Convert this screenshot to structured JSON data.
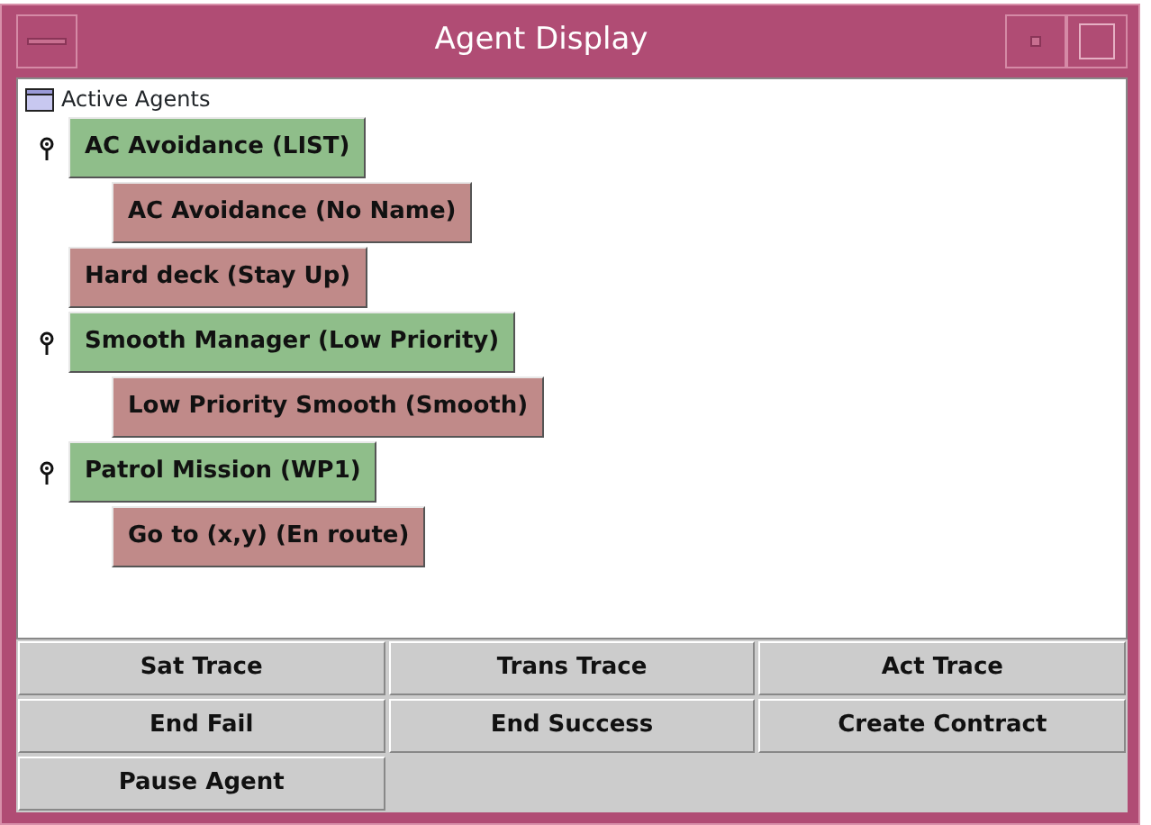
{
  "window": {
    "title": "Agent Display"
  },
  "tree": {
    "root": "Active Agents",
    "items": [
      {
        "label": "AC Avoidance (LIST)",
        "color": "#8fbe8a",
        "children": [
          {
            "label": "AC Avoidance (No Name)",
            "color": "#c08a89"
          }
        ]
      },
      {
        "label": "Hard deck (Stay Up)",
        "color": "#c08a89"
      },
      {
        "label": "Smooth Manager (Low Priority)",
        "color": "#8fbe8a",
        "children": [
          {
            "label": "Low Priority Smooth (Smooth)",
            "color": "#c08a89"
          }
        ]
      },
      {
        "label": "Patrol Mission (WP1)",
        "color": "#8fbe8a",
        "children": [
          {
            "label": "Go to (x,y) (En route)",
            "color": "#c08a89"
          }
        ]
      }
    ]
  },
  "buttons": [
    "Sat Trace",
    "Trans Trace",
    "Act Trace",
    "End Fail",
    "End Success",
    "Create Contract",
    "Pause Agent"
  ]
}
